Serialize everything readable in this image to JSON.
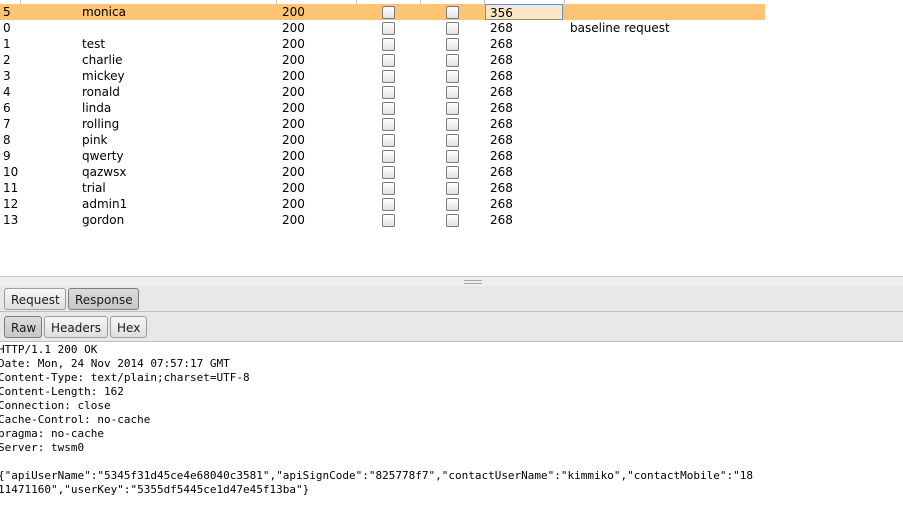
{
  "results": {
    "rows": [
      {
        "index": "5",
        "payload": "monica",
        "status": "200",
        "length": "356",
        "comment": "",
        "selected": true
      },
      {
        "index": "0",
        "payload": "",
        "status": "200",
        "length": "268",
        "comment": "baseline request",
        "selected": false
      },
      {
        "index": "1",
        "payload": "test",
        "status": "200",
        "length": "268",
        "comment": "",
        "selected": false
      },
      {
        "index": "2",
        "payload": "charlie",
        "status": "200",
        "length": "268",
        "comment": "",
        "selected": false
      },
      {
        "index": "3",
        "payload": "mickey",
        "status": "200",
        "length": "268",
        "comment": "",
        "selected": false
      },
      {
        "index": "4",
        "payload": "ronald",
        "status": "200",
        "length": "268",
        "comment": "",
        "selected": false
      },
      {
        "index": "6",
        "payload": "linda",
        "status": "200",
        "length": "268",
        "comment": "",
        "selected": false
      },
      {
        "index": "7",
        "payload": "rolling",
        "status": "200",
        "length": "268",
        "comment": "",
        "selected": false
      },
      {
        "index": "8",
        "payload": "pink",
        "status": "200",
        "length": "268",
        "comment": "",
        "selected": false
      },
      {
        "index": "9",
        "payload": "qwerty",
        "status": "200",
        "length": "268",
        "comment": "",
        "selected": false
      },
      {
        "index": "10",
        "payload": "qazwsx",
        "status": "200",
        "length": "268",
        "comment": "",
        "selected": false
      },
      {
        "index": "11",
        "payload": "trial",
        "status": "200",
        "length": "268",
        "comment": "",
        "selected": false
      },
      {
        "index": "12",
        "payload": "admin1",
        "status": "200",
        "length": "268",
        "comment": "",
        "selected": false
      },
      {
        "index": "13",
        "payload": "gordon",
        "status": "200",
        "length": "268",
        "comment": "",
        "selected": false
      }
    ]
  },
  "message_tabs": {
    "request_label": "Request",
    "response_label": "Response",
    "active": "Response"
  },
  "view_tabs": {
    "raw_label": "Raw",
    "headers_label": "Headers",
    "hex_label": "Hex",
    "active": "Raw"
  },
  "response": {
    "lines": [
      "HTTP/1.1 200 OK",
      "Date: Mon, 24 Nov 2014 07:57:17 GMT",
      "Content-Type: text/plain;charset=UTF-8",
      "Content-Length: 162",
      "Connection: close",
      "Cache-Control: no-cache",
      "pragma: no-cache",
      "Server: twsm0",
      "",
      "{\"apiUserName\":\"5345f31d45ce4e68040c3581\",\"apiSignCode\":\"825778f7\",\"contactUserName\":\"kimmiko\",\"contactMobile\":\"18",
      "11471160\",\"userKey\":\"5355df5445ce1d47e45f13ba\"}"
    ]
  },
  "colors": {
    "selected_row": "#fcc474",
    "tab_active": "#c6c6c6",
    "background": "#ffffff"
  }
}
